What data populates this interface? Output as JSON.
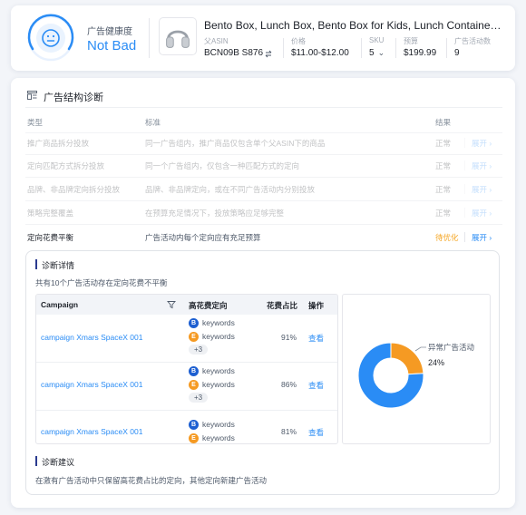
{
  "health": {
    "title": "广告健康度",
    "status": "Not Bad",
    "accent": "#2a8cf5"
  },
  "product": {
    "title": "Bento Box, Lunch Box, Bento Box for Kids, Lunch Containers for Adults",
    "meta": {
      "asin_label": "父ASIN",
      "asin_value": "BCN09B S876",
      "price_label": "价格",
      "price_value": "$11.00-$12.00",
      "sku_label": "SKU",
      "sku_value": "5",
      "budget_label": "预算",
      "budget_value": "$199.99",
      "count_label": "广告活动数",
      "count_value": "9"
    }
  },
  "diagnosis": {
    "title": "广告结构诊断",
    "columns": {
      "type": "类型",
      "standard": "标准",
      "result": "结果"
    },
    "rows": [
      {
        "type": "推广商品拆分投放",
        "standard": "同一广告组内，推广商品仅包含单个父ASIN下的商品",
        "result": "正常",
        "expand": "展开"
      },
      {
        "type": "定向匹配方式拆分投放",
        "standard": "同一个广告组内，仅包含一种匹配方式的定向",
        "result": "正常",
        "expand": "展开"
      },
      {
        "type": "品牌、非品牌定向拆分投放",
        "standard": "品牌、非品牌定向，或在不同广告活动内分别投放",
        "result": "正常",
        "expand": "展开"
      },
      {
        "type": "策略完整覆盖",
        "standard": "在预算充足情况下，投放策略应足够完整",
        "result": "正常",
        "expand": "展开"
      },
      {
        "type": "定向花费平衡",
        "standard": "广告活动内每个定向应有充足预算",
        "result": "待优化",
        "expand": "展开"
      }
    ],
    "warn_color": "#f5a623"
  },
  "detail": {
    "title": "诊断详情",
    "summary": "共有10个广告活动存在定向花费不平衡",
    "table": {
      "headers": {
        "campaign": "Campaign",
        "targeting": "高花费定向",
        "share": "花费占比",
        "action": "操作"
      },
      "rows": [
        {
          "campaign": "campaign Xmars SpaceX 001",
          "kw1": "keywords",
          "kw2": "keywords",
          "more": "+3",
          "share": "91%",
          "action": "查看"
        },
        {
          "campaign": "campaign Xmars SpaceX 001",
          "kw1": "keywords",
          "kw2": "keywords",
          "more": "+3",
          "share": "86%",
          "action": "查看"
        },
        {
          "campaign": "campaign Xmars SpaceX 001",
          "kw1": "keywords",
          "kw2": "keywords",
          "more": "",
          "share": "81%",
          "action": "查看"
        }
      ]
    },
    "advice_title": "诊断建议",
    "advice_text": "在激有广告活动中只保留高花费占比的定向，其他定向新建广告活动"
  },
  "chart_data": {
    "type": "pie",
    "slices": [
      {
        "label": "异常广告活动",
        "value": 24,
        "color": "#f59a23"
      },
      {
        "label": "",
        "value": 76,
        "color": "#2a8cf5"
      }
    ],
    "data_label": "24%",
    "legend_text": "异常广告活动"
  }
}
